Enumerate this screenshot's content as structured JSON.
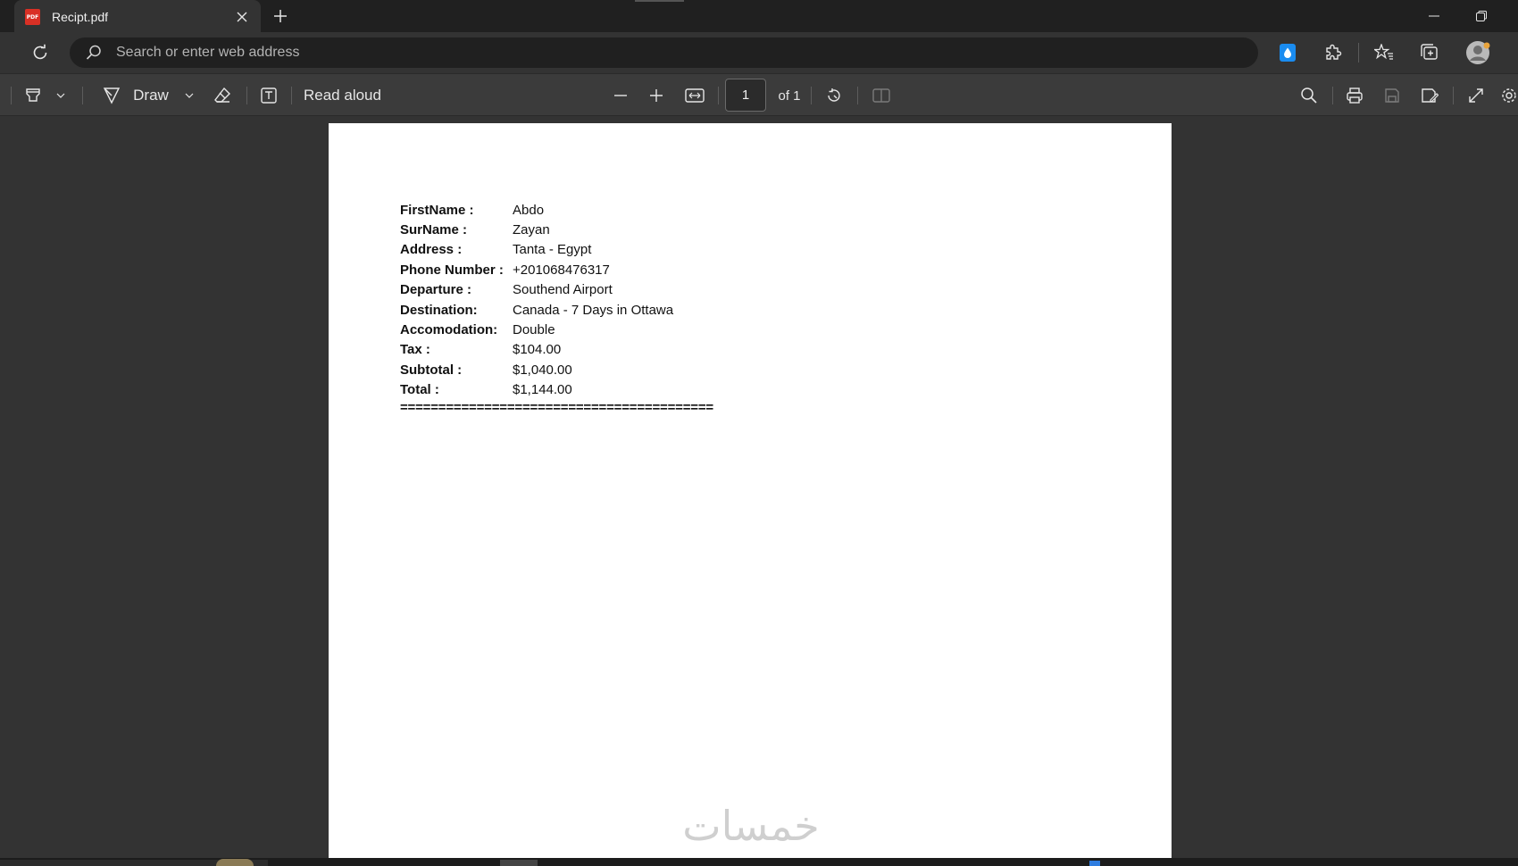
{
  "browser": {
    "tab_title": "Recipt.pdf",
    "pdf_badge": "PDF",
    "address_placeholder": "Search or enter web address"
  },
  "icons": {
    "tab": "pdf-file-icon",
    "close": "close-icon",
    "new_tab": "plus-icon",
    "minimize": "minimize-icon",
    "restore": "restore-icon",
    "reload": "reload-icon",
    "search": "search-icon",
    "extensions": [
      "droplet-icon",
      "puzzle-icon",
      "favorites-icon",
      "collections-icon",
      "profile-icon"
    ]
  },
  "pdf_toolbar": {
    "draw_label": "Draw",
    "read_aloud_label": "Read aloud",
    "page_current": "1",
    "page_total_label": "of 1"
  },
  "receipt": {
    "rows": [
      {
        "label": "FirstName :",
        "value": "Abdo"
      },
      {
        "label": "SurName :",
        "value": "Zayan"
      },
      {
        "label": "Address :",
        "value": "Tanta - Egypt"
      },
      {
        "label": "Phone Number :",
        "value": "+201068476317"
      },
      {
        "label": "Departure :",
        "value": "Southend Airport"
      },
      {
        "label": "Destination:",
        "value": "Canada - 7 Days in Ottawa"
      },
      {
        "label": "Accomodation:",
        "value": "Double"
      },
      {
        "label": "Tax :",
        "value": "$104.00"
      },
      {
        "label": "Subtotal :",
        "value": "$1,040.00"
      },
      {
        "label": "Total :",
        "value": "$1,144.00"
      }
    ],
    "rule": "========================================="
  },
  "watermark": "خمسات"
}
